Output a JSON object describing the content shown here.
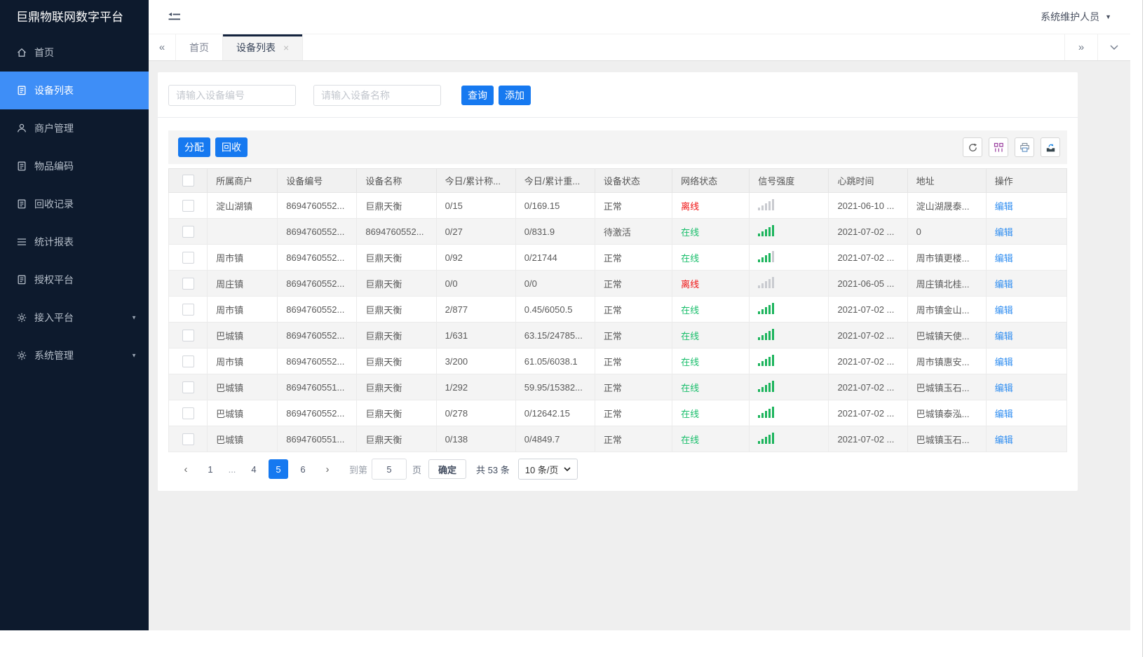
{
  "app": {
    "title": "巨鼎物联网数字平台",
    "user": "系统维护人员"
  },
  "sidebar": {
    "items": [
      {
        "key": "home",
        "label": "首页",
        "icon": "home",
        "active": false,
        "arrow": false
      },
      {
        "key": "device-list",
        "label": "设备列表",
        "icon": "doc",
        "active": true,
        "arrow": false
      },
      {
        "key": "merchant-mgmt",
        "label": "商户管理",
        "icon": "user",
        "active": false,
        "arrow": false
      },
      {
        "key": "item-code",
        "label": "物品编码",
        "icon": "doc",
        "active": false,
        "arrow": false
      },
      {
        "key": "recycle-record",
        "label": "回收记录",
        "icon": "doc",
        "active": false,
        "arrow": false
      },
      {
        "key": "stats-report",
        "label": "统计报表",
        "icon": "lines",
        "active": false,
        "arrow": false
      },
      {
        "key": "auth-platform",
        "label": "授权平台",
        "icon": "doc",
        "active": false,
        "arrow": false
      },
      {
        "key": "access-platform",
        "label": "接入平台",
        "icon": "gear",
        "active": false,
        "arrow": true
      },
      {
        "key": "system-mgmt",
        "label": "系统管理",
        "icon": "gear",
        "active": false,
        "arrow": true
      }
    ]
  },
  "tabs": {
    "scroll_left": "«",
    "scroll_right": "»",
    "items": [
      {
        "key": "home",
        "label": "首页",
        "active": false,
        "closable": false
      },
      {
        "key": "device-list",
        "label": "设备列表",
        "active": true,
        "closable": true
      }
    ]
  },
  "search": {
    "device_no_placeholder": "请输入设备编号",
    "device_name_placeholder": "请输入设备名称",
    "query_label": "查询",
    "add_label": "添加"
  },
  "toolbar": {
    "assign_label": "分配",
    "recycle_label": "回收",
    "icons": [
      {
        "key": "refresh",
        "name": "refresh-icon"
      },
      {
        "key": "columns",
        "name": "column-filter-icon"
      },
      {
        "key": "printer",
        "name": "printer-icon"
      },
      {
        "key": "export",
        "name": "export-icon"
      }
    ]
  },
  "table": {
    "headers": [
      "所属商户",
      "设备编号",
      "设备名称",
      "今日/累计称...",
      "今日/累计重...",
      "设备状态",
      "网络状态",
      "信号强度",
      "心跳时间",
      "地址",
      "操作"
    ],
    "rows": [
      {
        "merchant": "淀山湖镇",
        "device_no": "8694760552...",
        "device_name": "巨鼎天衡",
        "today_count": "0/15",
        "today_weight": "0/169.15",
        "status": "正常",
        "network": "离线",
        "online": false,
        "signal": 0,
        "heartbeat": "2021-06-10 ...",
        "address": "淀山湖晟泰...",
        "action": "编辑"
      },
      {
        "merchant": "",
        "device_no": "8694760552...",
        "device_name": "8694760552...",
        "today_count": "0/27",
        "today_weight": "0/831.9",
        "status": "待激活",
        "network": "在线",
        "online": true,
        "signal": 5,
        "heartbeat": "2021-07-02 ...",
        "address": "0",
        "action": "编辑"
      },
      {
        "merchant": "周市镇",
        "device_no": "8694760552...",
        "device_name": "巨鼎天衡",
        "today_count": "0/92",
        "today_weight": "0/21744",
        "status": "正常",
        "network": "在线",
        "online": true,
        "signal": 4,
        "heartbeat": "2021-07-02 ...",
        "address": "周市镇更楼...",
        "action": "编辑"
      },
      {
        "merchant": "周庄镇",
        "device_no": "8694760552...",
        "device_name": "巨鼎天衡",
        "today_count": "0/0",
        "today_weight": "0/0",
        "status": "正常",
        "network": "离线",
        "online": false,
        "signal": 0,
        "heartbeat": "2021-06-05 ...",
        "address": "周庄镇北桂...",
        "action": "编辑"
      },
      {
        "merchant": "周市镇",
        "device_no": "8694760552...",
        "device_name": "巨鼎天衡",
        "today_count": "2/877",
        "today_weight": "0.45/6050.5",
        "status": "正常",
        "network": "在线",
        "online": true,
        "signal": 5,
        "heartbeat": "2021-07-02 ...",
        "address": "周市镇金山...",
        "action": "编辑"
      },
      {
        "merchant": "巴城镇",
        "device_no": "8694760552...",
        "device_name": "巨鼎天衡",
        "today_count": "1/631",
        "today_weight": "63.15/24785...",
        "status": "正常",
        "network": "在线",
        "online": true,
        "signal": 5,
        "heartbeat": "2021-07-02 ...",
        "address": "巴城镇天使...",
        "action": "编辑"
      },
      {
        "merchant": "周市镇",
        "device_no": "8694760552...",
        "device_name": "巨鼎天衡",
        "today_count": "3/200",
        "today_weight": "61.05/6038.1",
        "status": "正常",
        "network": "在线",
        "online": true,
        "signal": 5,
        "heartbeat": "2021-07-02 ...",
        "address": "周市镇惠安...",
        "action": "编辑"
      },
      {
        "merchant": "巴城镇",
        "device_no": "8694760551...",
        "device_name": "巨鼎天衡",
        "today_count": "1/292",
        "today_weight": "59.95/15382...",
        "status": "正常",
        "network": "在线",
        "online": true,
        "signal": 5,
        "heartbeat": "2021-07-02 ...",
        "address": "巴城镇玉石...",
        "action": "编辑"
      },
      {
        "merchant": "巴城镇",
        "device_no": "8694760552...",
        "device_name": "巨鼎天衡",
        "today_count": "0/278",
        "today_weight": "0/12642.15",
        "status": "正常",
        "network": "在线",
        "online": true,
        "signal": 5,
        "heartbeat": "2021-07-02 ...",
        "address": "巴城镇泰泓...",
        "action": "编辑"
      },
      {
        "merchant": "巴城镇",
        "device_no": "8694760551...",
        "device_name": "巨鼎天衡",
        "today_count": "0/138",
        "today_weight": "0/4849.7",
        "status": "正常",
        "network": "在线",
        "online": true,
        "signal": 5,
        "heartbeat": "2021-07-02 ...",
        "address": "巴城镇玉石...",
        "action": "编辑"
      }
    ]
  },
  "pagination": {
    "prev": "‹",
    "next": "›",
    "pages": [
      {
        "label": "1",
        "active": false
      },
      {
        "label": "...",
        "active": false,
        "dots": true
      },
      {
        "label": "4",
        "active": false
      },
      {
        "label": "5",
        "active": true
      },
      {
        "label": "6",
        "active": false
      }
    ],
    "jump_label": "到第",
    "jump_value": "5",
    "page_unit": "页",
    "confirm_label": "确定",
    "total_label": "共 53 条",
    "page_size": "10 条/页"
  },
  "colors": {
    "sidebar_bg": "#0d1a2d",
    "active_item": "#3e8ef7",
    "primary_button": "#1679f0",
    "online_green": "#19be6b",
    "offline_red": "#f01414",
    "link_blue": "#2d8cf0"
  }
}
